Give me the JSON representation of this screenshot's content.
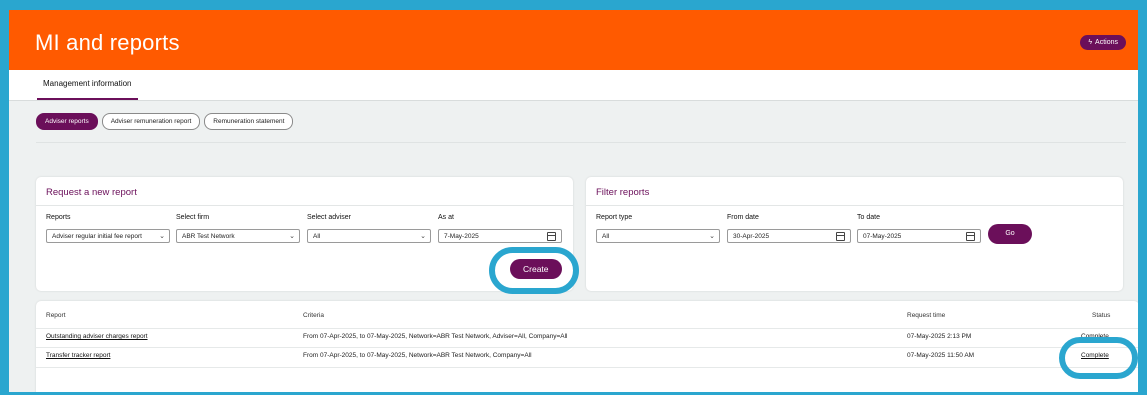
{
  "header": {
    "title": "MI and reports",
    "actions_label": "Actions"
  },
  "tabs": [
    {
      "label": "Management information"
    }
  ],
  "subtabs": [
    {
      "label": "Adviser reports"
    },
    {
      "label": "Adviser remuneration report"
    },
    {
      "label": "Remuneration statement"
    }
  ],
  "request": {
    "title": "Request a new report",
    "reports_label": "Reports",
    "reports_value": "Adviser regular initial fee report",
    "firm_label": "Select firm",
    "firm_value": "ABR Test Network",
    "adviser_label": "Select adviser",
    "adviser_value": "All",
    "asat_label": "As at",
    "asat_value": "7-May-2025",
    "create_label": "Create"
  },
  "filter": {
    "title": "Filter reports",
    "type_label": "Report type",
    "type_value": "All",
    "from_label": "From date",
    "from_value": "30-Apr-2025",
    "to_label": "To date",
    "to_value": "07-May-2025",
    "go_label": "Go"
  },
  "table": {
    "headers": {
      "report": "Report",
      "criteria": "Criteria",
      "time": "Request time",
      "status": "Status"
    },
    "rows": [
      {
        "report": "Outstanding adviser charges report",
        "criteria": "From 07-Apr-2025, to 07-May-2025, Network=ABR Test Network, Adviser=All, Company=All",
        "time": "07-May-2025 2:13 PM",
        "status": "Complete"
      },
      {
        "report": "Transfer tracker report",
        "criteria": "From 07-Apr-2025, to 07-May-2025, Network=ABR Test Network, Company=All",
        "time": "07-May-2025 11:50 AM",
        "status": "Complete"
      }
    ]
  },
  "colors": {
    "brand": "#ff5a00",
    "accent": "#6b0f5a",
    "highlight_ring": "#2aa6cf"
  },
  "icons": {
    "actions": "lightning-icon",
    "dropdown": "chevron-down-icon",
    "date": "calendar-icon"
  }
}
